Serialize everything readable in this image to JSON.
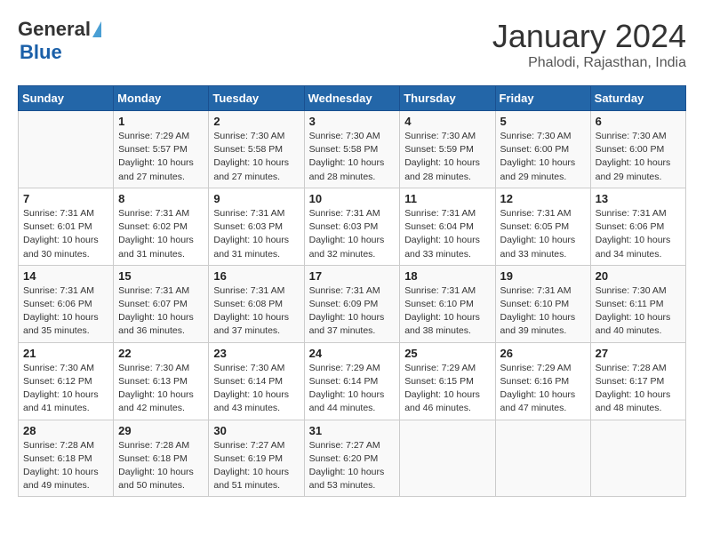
{
  "header": {
    "logo_general": "General",
    "logo_blue": "Blue",
    "title": "January 2024",
    "subtitle": "Phalodi, Rajasthan, India"
  },
  "days_of_week": [
    "Sunday",
    "Monday",
    "Tuesday",
    "Wednesday",
    "Thursday",
    "Friday",
    "Saturday"
  ],
  "weeks": [
    [
      {
        "day": "",
        "info": ""
      },
      {
        "day": "1",
        "info": "Sunrise: 7:29 AM\nSunset: 5:57 PM\nDaylight: 10 hours\nand 27 minutes."
      },
      {
        "day": "2",
        "info": "Sunrise: 7:30 AM\nSunset: 5:58 PM\nDaylight: 10 hours\nand 27 minutes."
      },
      {
        "day": "3",
        "info": "Sunrise: 7:30 AM\nSunset: 5:58 PM\nDaylight: 10 hours\nand 28 minutes."
      },
      {
        "day": "4",
        "info": "Sunrise: 7:30 AM\nSunset: 5:59 PM\nDaylight: 10 hours\nand 28 minutes."
      },
      {
        "day": "5",
        "info": "Sunrise: 7:30 AM\nSunset: 6:00 PM\nDaylight: 10 hours\nand 29 minutes."
      },
      {
        "day": "6",
        "info": "Sunrise: 7:30 AM\nSunset: 6:00 PM\nDaylight: 10 hours\nand 29 minutes."
      }
    ],
    [
      {
        "day": "7",
        "info": "Sunrise: 7:31 AM\nSunset: 6:01 PM\nDaylight: 10 hours\nand 30 minutes."
      },
      {
        "day": "8",
        "info": "Sunrise: 7:31 AM\nSunset: 6:02 PM\nDaylight: 10 hours\nand 31 minutes."
      },
      {
        "day": "9",
        "info": "Sunrise: 7:31 AM\nSunset: 6:03 PM\nDaylight: 10 hours\nand 31 minutes."
      },
      {
        "day": "10",
        "info": "Sunrise: 7:31 AM\nSunset: 6:03 PM\nDaylight: 10 hours\nand 32 minutes."
      },
      {
        "day": "11",
        "info": "Sunrise: 7:31 AM\nSunset: 6:04 PM\nDaylight: 10 hours\nand 33 minutes."
      },
      {
        "day": "12",
        "info": "Sunrise: 7:31 AM\nSunset: 6:05 PM\nDaylight: 10 hours\nand 33 minutes."
      },
      {
        "day": "13",
        "info": "Sunrise: 7:31 AM\nSunset: 6:06 PM\nDaylight: 10 hours\nand 34 minutes."
      }
    ],
    [
      {
        "day": "14",
        "info": "Sunrise: 7:31 AM\nSunset: 6:06 PM\nDaylight: 10 hours\nand 35 minutes."
      },
      {
        "day": "15",
        "info": "Sunrise: 7:31 AM\nSunset: 6:07 PM\nDaylight: 10 hours\nand 36 minutes."
      },
      {
        "day": "16",
        "info": "Sunrise: 7:31 AM\nSunset: 6:08 PM\nDaylight: 10 hours\nand 37 minutes."
      },
      {
        "day": "17",
        "info": "Sunrise: 7:31 AM\nSunset: 6:09 PM\nDaylight: 10 hours\nand 37 minutes."
      },
      {
        "day": "18",
        "info": "Sunrise: 7:31 AM\nSunset: 6:10 PM\nDaylight: 10 hours\nand 38 minutes."
      },
      {
        "day": "19",
        "info": "Sunrise: 7:31 AM\nSunset: 6:10 PM\nDaylight: 10 hours\nand 39 minutes."
      },
      {
        "day": "20",
        "info": "Sunrise: 7:30 AM\nSunset: 6:11 PM\nDaylight: 10 hours\nand 40 minutes."
      }
    ],
    [
      {
        "day": "21",
        "info": "Sunrise: 7:30 AM\nSunset: 6:12 PM\nDaylight: 10 hours\nand 41 minutes."
      },
      {
        "day": "22",
        "info": "Sunrise: 7:30 AM\nSunset: 6:13 PM\nDaylight: 10 hours\nand 42 minutes."
      },
      {
        "day": "23",
        "info": "Sunrise: 7:30 AM\nSunset: 6:14 PM\nDaylight: 10 hours\nand 43 minutes."
      },
      {
        "day": "24",
        "info": "Sunrise: 7:29 AM\nSunset: 6:14 PM\nDaylight: 10 hours\nand 44 minutes."
      },
      {
        "day": "25",
        "info": "Sunrise: 7:29 AM\nSunset: 6:15 PM\nDaylight: 10 hours\nand 46 minutes."
      },
      {
        "day": "26",
        "info": "Sunrise: 7:29 AM\nSunset: 6:16 PM\nDaylight: 10 hours\nand 47 minutes."
      },
      {
        "day": "27",
        "info": "Sunrise: 7:28 AM\nSunset: 6:17 PM\nDaylight: 10 hours\nand 48 minutes."
      }
    ],
    [
      {
        "day": "28",
        "info": "Sunrise: 7:28 AM\nSunset: 6:18 PM\nDaylight: 10 hours\nand 49 minutes."
      },
      {
        "day": "29",
        "info": "Sunrise: 7:28 AM\nSunset: 6:18 PM\nDaylight: 10 hours\nand 50 minutes."
      },
      {
        "day": "30",
        "info": "Sunrise: 7:27 AM\nSunset: 6:19 PM\nDaylight: 10 hours\nand 51 minutes."
      },
      {
        "day": "31",
        "info": "Sunrise: 7:27 AM\nSunset: 6:20 PM\nDaylight: 10 hours\nand 53 minutes."
      },
      {
        "day": "",
        "info": ""
      },
      {
        "day": "",
        "info": ""
      },
      {
        "day": "",
        "info": ""
      }
    ]
  ]
}
